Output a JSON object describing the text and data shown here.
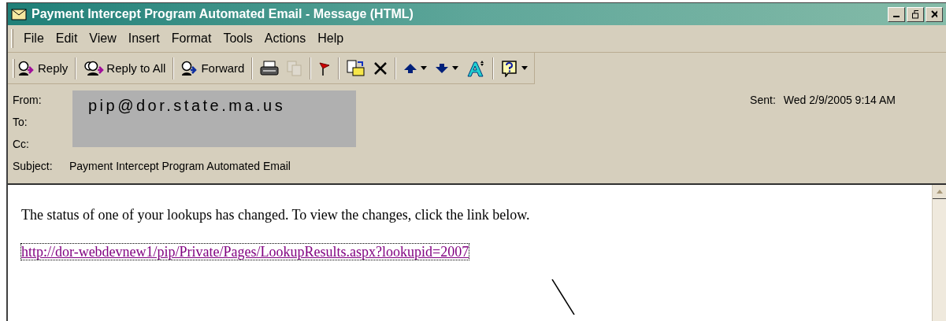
{
  "window": {
    "title": "Payment Intercept Program Automated Email - Message (HTML)"
  },
  "menu": [
    {
      "label": "File"
    },
    {
      "label": "Edit"
    },
    {
      "label": "View"
    },
    {
      "label": "Insert"
    },
    {
      "label": "Format"
    },
    {
      "label": "Tools"
    },
    {
      "label": "Actions"
    },
    {
      "label": "Help"
    }
  ],
  "toolbar": {
    "buttons": [
      {
        "label": "Reply"
      },
      {
        "label": "Reply to All"
      },
      {
        "label": "Forward"
      }
    ],
    "tools": [
      {
        "disabled": false,
        "dropdown": false
      },
      {
        "disabled": true,
        "dropdown": false
      },
      {
        "disabled": false,
        "dropdown": false
      },
      {
        "disabled": false,
        "dropdown": false
      },
      {
        "disabled": false,
        "dropdown": false
      },
      {
        "disabled": false,
        "dropdown": true
      },
      {
        "disabled": false,
        "dropdown": true
      },
      {
        "disabled": false,
        "dropdown": false
      },
      {
        "disabled": false,
        "dropdown": true
      }
    ]
  },
  "header": {
    "fields": [
      {
        "label": "From:"
      },
      {
        "label": "To:"
      },
      {
        "label": "Cc:"
      },
      {
        "label": "Subject:",
        "value": "Payment Intercept Program Automated Email"
      }
    ],
    "redaction": {
      "text": "pip@dor.state.ma.us"
    },
    "sent": {
      "label": "Sent:",
      "value": "Wed 2/9/2005 9:14 AM"
    }
  },
  "body": {
    "paragraph": "The status of one of your lookups has changed. To view the changes, click the link below.",
    "link": "http://dor-webdevnew1/pip/Private/Pages/LookupResults.aspx?lookupid=2007"
  }
}
